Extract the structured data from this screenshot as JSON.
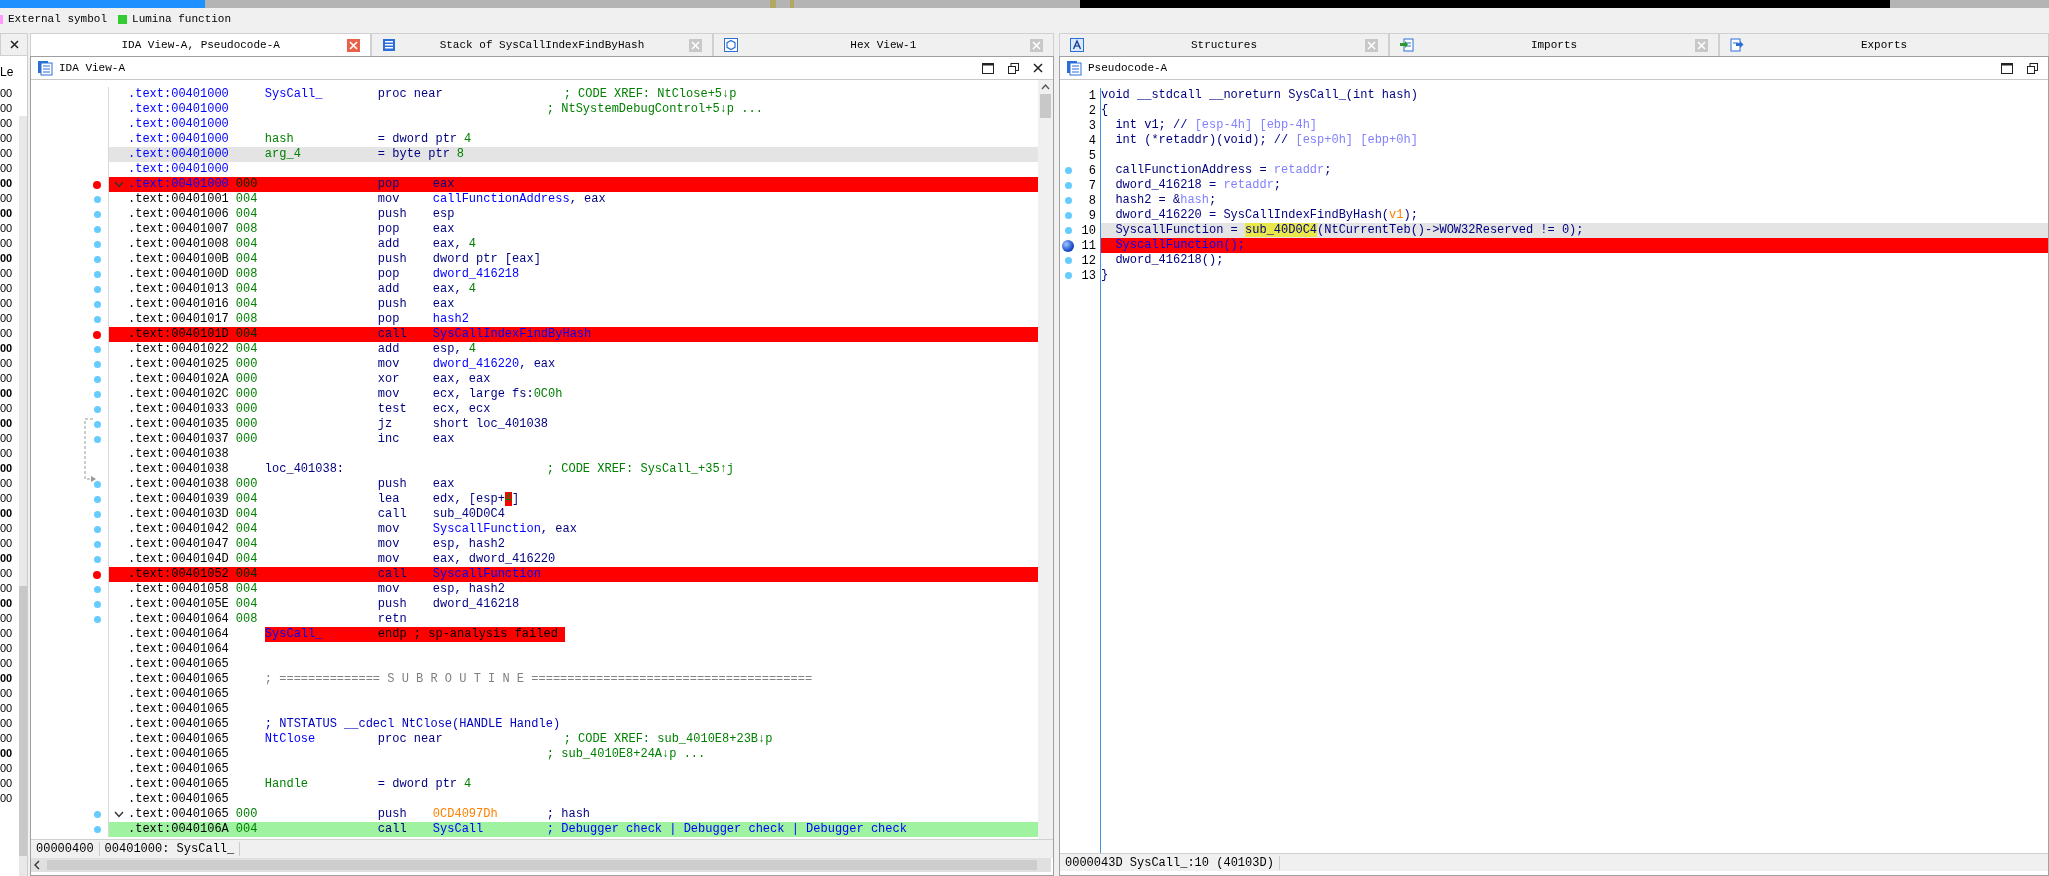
{
  "legend": [
    {
      "label": "External symbol",
      "color": "#ff99ff"
    },
    {
      "label": "Lumina function",
      "color": "#33cc33"
    }
  ],
  "side_panel": {
    "title": "Le",
    "items": [
      {
        "text": "00",
        "bold": false
      },
      {
        "text": "00",
        "bold": false
      },
      {
        "text": "00",
        "bold": false
      },
      {
        "text": "00",
        "bold": false
      },
      {
        "text": "00",
        "bold": false
      },
      {
        "text": "00",
        "bold": false
      },
      {
        "text": "00",
        "bold": true
      },
      {
        "text": "00",
        "bold": false
      },
      {
        "text": "00",
        "bold": true
      },
      {
        "text": "00",
        "bold": false
      },
      {
        "text": "00",
        "bold": false
      },
      {
        "text": "00",
        "bold": true
      },
      {
        "text": "00",
        "bold": false
      },
      {
        "text": "00",
        "bold": false
      },
      {
        "text": "00",
        "bold": false
      },
      {
        "text": "00",
        "bold": false
      },
      {
        "text": "00",
        "bold": false
      },
      {
        "text": "00",
        "bold": true
      },
      {
        "text": "00",
        "bold": false
      },
      {
        "text": "00",
        "bold": false
      },
      {
        "text": "00",
        "bold": true
      },
      {
        "text": "00",
        "bold": false
      },
      {
        "text": "00",
        "bold": true
      },
      {
        "text": "00",
        "bold": false
      },
      {
        "text": "00",
        "bold": false
      },
      {
        "text": "00",
        "bold": true
      },
      {
        "text": "00",
        "bold": false
      },
      {
        "text": "00",
        "bold": false
      },
      {
        "text": "00",
        "bold": true
      },
      {
        "text": "00",
        "bold": false
      },
      {
        "text": "00",
        "bold": false
      },
      {
        "text": "00",
        "bold": true
      },
      {
        "text": "00",
        "bold": false
      },
      {
        "text": "00",
        "bold": false
      },
      {
        "text": "00",
        "bold": true
      },
      {
        "text": "00",
        "bold": false
      },
      {
        "text": "00",
        "bold": false
      },
      {
        "text": "00",
        "bold": false
      },
      {
        "text": "00",
        "bold": false
      },
      {
        "text": "00",
        "bold": true
      },
      {
        "text": "00",
        "bold": false
      },
      {
        "text": "00",
        "bold": false
      },
      {
        "text": "00",
        "bold": false
      },
      {
        "text": "00",
        "bold": false
      },
      {
        "text": "00",
        "bold": true
      },
      {
        "text": "00",
        "bold": false
      },
      {
        "text": "00",
        "bold": false
      },
      {
        "text": "00",
        "bold": false
      }
    ]
  },
  "tabs_left": [
    {
      "label": "IDA View-A, Pseudocode-A",
      "selected": true,
      "kind": "plain",
      "closable": true
    },
    {
      "label": "Stack of SysCallIndexFindByHash",
      "selected": false,
      "kind": "stack",
      "closable": true
    },
    {
      "label": "Hex View-1",
      "selected": false,
      "kind": "hex",
      "closable": true
    }
  ],
  "tabs_right": [
    {
      "label": "Structures",
      "selected": false,
      "kind": "struct",
      "closable": true
    },
    {
      "label": "Imports",
      "selected": false,
      "kind": "import",
      "closable": true
    },
    {
      "label": "Exports",
      "selected": false,
      "kind": "export",
      "closable": false
    }
  ],
  "disassembly": {
    "title": "IDA View-A",
    "status": [
      "00000400",
      "00401000: SysCall_"
    ],
    "lines": [
      {
        "addr": ".text:00401000",
        "head": true,
        "kind": "normal",
        "traced": false,
        "fold": false,
        "label": {
          "text": "SysCall_",
          "kind": "func"
        },
        "mnem": "proc near",
        "comment": {
          "text": "; CODE XREF: NtClose+5↓p",
          "kind": "xref"
        }
      },
      {
        "addr": ".text:00401000",
        "head": true,
        "kind": "normal",
        "traced": false,
        "fold": false,
        "comment": {
          "text": "; NtSystemDebugControl+5↓p ...",
          "kind": "xref"
        }
      },
      {
        "addr": ".text:00401000",
        "head": true,
        "kind": "normal",
        "traced": false,
        "fold": false
      },
      {
        "addr": ".text:00401000",
        "head": true,
        "kind": "normal",
        "traced": false,
        "fold": false,
        "label": {
          "text": "hash",
          "kind": "var"
        },
        "mnem": "= dword ptr",
        "ops": [
          {
            "text": "4",
            "kind": "num"
          }
        ]
      },
      {
        "addr": ".text:00401000",
        "head": true,
        "kind": "cursor",
        "traced": false,
        "fold": false,
        "label": {
          "text": "arg_4",
          "kind": "var"
        },
        "mnem": "= byte ptr",
        "ops": [
          {
            "text": "8",
            "kind": "num"
          }
        ]
      },
      {
        "addr": ".text:00401000",
        "head": true,
        "kind": "normal",
        "traced": false,
        "fold": false
      },
      {
        "addr": ".text:00401000",
        "head": true,
        "kind": "breakpoint",
        "traced": false,
        "fold": true,
        "sp": "000",
        "mnem": "pop",
        "ops": [
          {
            "text": "eax",
            "kind": "reg"
          }
        ]
      },
      {
        "addr": ".text:00401001",
        "head": false,
        "kind": "normal",
        "traced": true,
        "fold": false,
        "sp": "004",
        "mnem": "mov",
        "ops": [
          {
            "text": "callFunctionAddress",
            "kind": "name"
          },
          {
            "text": ", eax",
            "kind": "reg"
          }
        ]
      },
      {
        "addr": ".text:00401006",
        "head": false,
        "kind": "normal",
        "traced": true,
        "fold": false,
        "sp": "004",
        "mnem": "push",
        "ops": [
          {
            "text": "esp",
            "kind": "reg"
          }
        ]
      },
      {
        "addr": ".text:00401007",
        "head": false,
        "kind": "normal",
        "traced": true,
        "fold": false,
        "sp": "008",
        "mnem": "pop",
        "ops": [
          {
            "text": "eax",
            "kind": "reg"
          }
        ]
      },
      {
        "addr": ".text:00401008",
        "head": false,
        "kind": "normal",
        "traced": true,
        "fold": false,
        "sp": "004",
        "mnem": "add",
        "ops": [
          {
            "text": "eax, ",
            "kind": "reg"
          },
          {
            "text": "4",
            "kind": "num"
          }
        ]
      },
      {
        "addr": ".text:0040100B",
        "head": false,
        "kind": "normal",
        "traced": true,
        "fold": false,
        "sp": "004",
        "mnem": "push",
        "ops": [
          {
            "text": "dword ptr [eax]",
            "kind": "reg"
          }
        ]
      },
      {
        "addr": ".text:0040100D",
        "head": false,
        "kind": "normal",
        "traced": true,
        "fold": false,
        "sp": "008",
        "mnem": "pop",
        "ops": [
          {
            "text": "dword_416218",
            "kind": "name"
          }
        ]
      },
      {
        "addr": ".text:00401013",
        "head": false,
        "kind": "normal",
        "traced": true,
        "fold": false,
        "sp": "004",
        "mnem": "add",
        "ops": [
          {
            "text": "eax, ",
            "kind": "reg"
          },
          {
            "text": "4",
            "kind": "num"
          }
        ]
      },
      {
        "addr": ".text:00401016",
        "head": false,
        "kind": "normal",
        "traced": true,
        "fold": false,
        "sp": "004",
        "mnem": "push",
        "ops": [
          {
            "text": "eax",
            "kind": "reg"
          }
        ]
      },
      {
        "addr": ".text:00401017",
        "head": false,
        "kind": "normal",
        "traced": true,
        "fold": false,
        "sp": "008",
        "mnem": "pop",
        "ops": [
          {
            "text": "hash2",
            "kind": "name"
          }
        ]
      },
      {
        "addr": ".text:0040101D",
        "head": false,
        "kind": "breakpoint",
        "traced": false,
        "fold": false,
        "sp": "004",
        "mnem": "call",
        "ops": [
          {
            "text": "SysCallIndexFindByHash",
            "kind": "name"
          }
        ]
      },
      {
        "addr": ".text:00401022",
        "head": false,
        "kind": "normal",
        "traced": true,
        "fold": false,
        "sp": "004",
        "mnem": "add",
        "ops": [
          {
            "text": "esp, ",
            "kind": "reg"
          },
          {
            "text": "4",
            "kind": "num"
          }
        ]
      },
      {
        "addr": ".text:00401025",
        "head": false,
        "kind": "normal",
        "traced": true,
        "fold": false,
        "sp": "000",
        "mnem": "mov",
        "ops": [
          {
            "text": "dword_416220",
            "kind": "name"
          },
          {
            "text": ", eax",
            "kind": "reg"
          }
        ]
      },
      {
        "addr": ".text:0040102A",
        "head": false,
        "kind": "normal",
        "traced": true,
        "fold": false,
        "sp": "000",
        "mnem": "xor",
        "ops": [
          {
            "text": "eax, eax",
            "kind": "reg"
          }
        ]
      },
      {
        "addr": ".text:0040102C",
        "head": false,
        "kind": "normal",
        "traced": true,
        "fold": false,
        "sp": "000",
        "mnem": "mov",
        "ops": [
          {
            "text": "ecx, large fs:",
            "kind": "reg"
          },
          {
            "text": "0C0h",
            "kind": "num"
          }
        ]
      },
      {
        "addr": ".text:00401033",
        "head": false,
        "kind": "normal",
        "traced": true,
        "fold": false,
        "sp": "000",
        "mnem": "test",
        "ops": [
          {
            "text": "ecx, ecx",
            "kind": "reg"
          }
        ]
      },
      {
        "addr": ".text:00401035",
        "head": false,
        "kind": "normal",
        "traced": true,
        "fold": false,
        "sp": "000",
        "mnem": "jz",
        "ops": [
          {
            "text": "short loc_401038",
            "kind": "reg"
          }
        ]
      },
      {
        "addr": ".text:00401037",
        "head": false,
        "kind": "normal",
        "traced": true,
        "fold": false,
        "sp": "000",
        "mnem": "inc",
        "ops": [
          {
            "text": "eax",
            "kind": "reg"
          }
        ]
      },
      {
        "addr": ".text:00401038",
        "head": false,
        "kind": "normal",
        "traced": false,
        "fold": false
      },
      {
        "addr": ".text:00401038",
        "head": false,
        "kind": "normal",
        "traced": false,
        "fold": false,
        "label": {
          "text": "loc_401038:",
          "kind": "loc"
        },
        "comment": {
          "text": "; CODE XREF: SysCall_+35↑j",
          "kind": "xref"
        }
      },
      {
        "addr": ".text:00401038",
        "head": false,
        "kind": "normal",
        "traced": true,
        "fold": false,
        "sp": "000",
        "mnem": "push",
        "ops": [
          {
            "text": "eax",
            "kind": "reg"
          }
        ]
      },
      {
        "addr": ".text:00401039",
        "head": false,
        "kind": "normal",
        "traced": true,
        "fold": false,
        "sp": "004",
        "mnem": "lea",
        "ops": [
          {
            "text": "edx, [esp+",
            "kind": "reg"
          },
          {
            "text": "4",
            "kind": "hot"
          },
          {
            "text": "]",
            "kind": "reg"
          }
        ]
      },
      {
        "addr": ".text:0040103D",
        "head": false,
        "kind": "normal",
        "traced": true,
        "fold": false,
        "sp": "004",
        "mnem": "call",
        "ops": [
          {
            "text": "sub_40D0C4",
            "kind": "reg"
          }
        ]
      },
      {
        "addr": ".text:00401042",
        "head": false,
        "kind": "normal",
        "traced": true,
        "fold": false,
        "sp": "004",
        "mnem": "mov",
        "ops": [
          {
            "text": "SyscallFunction",
            "kind": "name"
          },
          {
            "text": ", eax",
            "kind": "reg"
          }
        ]
      },
      {
        "addr": ".text:00401047",
        "head": false,
        "kind": "normal",
        "traced": true,
        "fold": false,
        "sp": "004",
        "mnem": "mov",
        "ops": [
          {
            "text": "esp, hash2",
            "kind": "reg"
          }
        ]
      },
      {
        "addr": ".text:0040104D",
        "head": false,
        "kind": "normal",
        "traced": true,
        "fold": false,
        "sp": "004",
        "mnem": "mov",
        "ops": [
          {
            "text": "eax, dword_416220",
            "kind": "reg"
          }
        ]
      },
      {
        "addr": ".text:00401052",
        "head": false,
        "kind": "breakpoint",
        "traced": false,
        "fold": false,
        "sp": "004",
        "mnem": "call",
        "ops": [
          {
            "text": "SyscallFunction",
            "kind": "name"
          }
        ]
      },
      {
        "addr": ".text:00401058",
        "head": false,
        "kind": "normal",
        "traced": true,
        "fold": false,
        "sp": "004",
        "mnem": "mov",
        "ops": [
          {
            "text": "esp, hash2",
            "kind": "reg"
          }
        ]
      },
      {
        "addr": ".text:0040105E",
        "head": false,
        "kind": "normal",
        "traced": true,
        "fold": false,
        "sp": "004",
        "mnem": "push",
        "ops": [
          {
            "text": "dword_416218",
            "kind": "reg"
          }
        ]
      },
      {
        "addr": ".text:00401064",
        "head": false,
        "kind": "normal",
        "traced": true,
        "fold": false,
        "sp": "008",
        "mnem": "retn"
      },
      {
        "addr": ".text:00401064",
        "head": false,
        "kind": "error",
        "traced": false,
        "fold": false,
        "label": {
          "text": "SysCall_",
          "kind": "func"
        },
        "mnem": "endp ; sp-analysis failed"
      },
      {
        "addr": ".text:00401064",
        "head": false,
        "kind": "normal",
        "traced": false,
        "fold": false
      },
      {
        "addr": ".text:00401065",
        "head": false,
        "kind": "normal",
        "traced": false,
        "fold": false
      },
      {
        "addr": ".text:00401065",
        "head": false,
        "kind": "normal",
        "traced": false,
        "fold": false,
        "label": {
          "text": "; ============== S U B R O U T I N E =======================================",
          "kind": "sep"
        }
      },
      {
        "addr": ".text:00401065",
        "head": false,
        "kind": "normal",
        "traced": false,
        "fold": false
      },
      {
        "addr": ".text:00401065",
        "head": false,
        "kind": "normal",
        "traced": false,
        "fold": false
      },
      {
        "addr": ".text:00401065",
        "head": false,
        "kind": "normal",
        "traced": false,
        "fold": false,
        "label": {
          "text": "; NTSTATUS __cdecl NtClose(HANDLE Handle)",
          "kind": "proto"
        }
      },
      {
        "addr": ".text:00401065",
        "head": false,
        "kind": "normal",
        "traced": false,
        "fold": false,
        "label": {
          "text": "NtClose",
          "kind": "func"
        },
        "mnem": "proc near",
        "comment": {
          "text": "; CODE XREF: sub_4010E8+23B↓p",
          "kind": "xref"
        }
      },
      {
        "addr": ".text:00401065",
        "head": false,
        "kind": "normal",
        "traced": false,
        "fold": false,
        "comment": {
          "text": "; sub_4010E8+24A↓p ...",
          "kind": "xref"
        }
      },
      {
        "addr": ".text:00401065",
        "head": false,
        "kind": "normal",
        "traced": false,
        "fold": false
      },
      {
        "addr": ".text:00401065",
        "head": false,
        "kind": "normal",
        "traced": false,
        "fold": false,
        "label": {
          "text": "Handle",
          "kind": "var"
        },
        "mnem": "= dword ptr",
        "ops": [
          {
            "text": "4",
            "kind": "num"
          }
        ]
      },
      {
        "addr": ".text:00401065",
        "head": false,
        "kind": "normal",
        "traced": false,
        "fold": false
      },
      {
        "addr": ".text:00401065",
        "head": false,
        "kind": "normal",
        "traced": true,
        "fold": true,
        "sp": "000",
        "mnem": "push",
        "ops": [
          {
            "text": "0CD4097Dh",
            "kind": "imm"
          }
        ],
        "comment": {
          "text": "; hash",
          "kind": "note"
        }
      },
      {
        "addr": ".text:0040106A",
        "head": false,
        "kind": "lumina",
        "traced": true,
        "fold": false,
        "sp": "004",
        "mnem": "call",
        "ops": [
          {
            "text": "SysCall",
            "kind": "name"
          }
        ],
        "comment": {
          "text": "; Debugger check | Debugger check | Debugger check",
          "kind": "auto"
        }
      }
    ]
  },
  "pseudocode": {
    "title": "Pseudocode-A",
    "status": "0000043D SysCall_:10 (40103D)",
    "lines": [
      {
        "number": "1",
        "kind": "normal",
        "traced": false,
        "segments": [
          {
            "text": "void __stdcall __noreturn SysCall_(int hash)",
            "kind": "code"
          }
        ]
      },
      {
        "number": "2",
        "kind": "normal",
        "traced": false,
        "segments": [
          {
            "text": "{",
            "kind": "code"
          }
        ]
      },
      {
        "number": "3",
        "kind": "normal",
        "traced": false,
        "segments": [
          {
            "text": "  int v1; // ",
            "kind": "code"
          },
          {
            "text": "[esp-4h] [ebp-4h]",
            "kind": "var"
          }
        ]
      },
      {
        "number": "4",
        "kind": "normal",
        "traced": false,
        "segments": [
          {
            "text": "  int (*retaddr)(void); // ",
            "kind": "code"
          },
          {
            "text": "[esp+0h] [ebp+0h]",
            "kind": "var"
          }
        ]
      },
      {
        "number": "5",
        "kind": "normal",
        "traced": false
      },
      {
        "number": "6",
        "kind": "normal",
        "traced": true,
        "segments": [
          {
            "text": "  callFunctionAddress = ",
            "kind": "code"
          },
          {
            "text": "retaddr",
            "kind": "var"
          },
          {
            "text": ";",
            "kind": "code"
          }
        ]
      },
      {
        "number": "7",
        "kind": "normal",
        "traced": true,
        "segments": [
          {
            "text": "  dword_416218 = ",
            "kind": "code"
          },
          {
            "text": "retaddr",
            "kind": "var"
          },
          {
            "text": ";",
            "kind": "code"
          }
        ]
      },
      {
        "number": "8",
        "kind": "normal",
        "traced": true,
        "segments": [
          {
            "text": "  hash2 = &",
            "kind": "code"
          },
          {
            "text": "hash",
            "kind": "var"
          },
          {
            "text": ";",
            "kind": "code"
          }
        ]
      },
      {
        "number": "9",
        "kind": "normal",
        "traced": true,
        "segments": [
          {
            "text": "  dword_416220 = SysCallIndexFindByHash(",
            "kind": "code"
          },
          {
            "text": "v1",
            "kind": "arg"
          },
          {
            "text": ");",
            "kind": "code"
          }
        ]
      },
      {
        "number": "10",
        "kind": "cursor",
        "traced": true,
        "segments": [
          {
            "text": "  SyscallFunction = ",
            "kind": "code"
          },
          {
            "text": "sub_40D0C4",
            "kind": "sel"
          },
          {
            "text": "(NtCurrentTeb()->WOW32Reserved != 0);",
            "kind": "code"
          }
        ]
      },
      {
        "number": "11",
        "kind": "breakpoint",
        "traced": false,
        "segments": [
          {
            "text": "  SyscallFunction();",
            "kind": "name"
          }
        ]
      },
      {
        "number": "12",
        "kind": "normal",
        "traced": true,
        "segments": [
          {
            "text": "  dword_416218();",
            "kind": "code"
          }
        ]
      },
      {
        "number": "13",
        "kind": "normal",
        "traced": true,
        "segments": [
          {
            "text": "}",
            "kind": "code"
          }
        ]
      }
    ]
  }
}
